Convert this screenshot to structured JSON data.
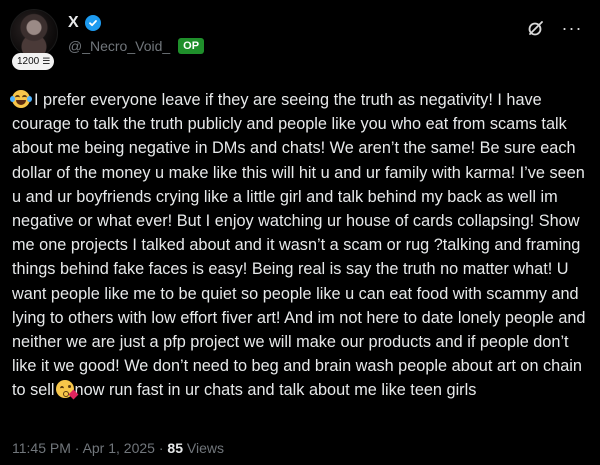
{
  "author": {
    "display_name": "X",
    "handle": "@_Necro_Void_",
    "op_badge": "OP",
    "level": "1200"
  },
  "icons": {
    "verified": "verified-check-icon",
    "grok": "grok-icon",
    "more": "more-icon"
  },
  "post": {
    "text_part1": "I prefer everyone leave if they are seeing the truth as negativity! I have courage to talk the truth publicly and people like you who eat from scams talk about me being negative in DMs and chats! We aren’t the same! Be sure each dollar of the money u make like this will hit u and ur family with karma! I’ve seen u and ur boyfriends crying like a little girl and talk behind my back as well im negative or what ever! But I enjoy watching ur house of cards collapsing! Show me one projects I talked about and it wasn’t a scam or rug ?talking and framing things behind fake faces is easy! Being real is say the truth no matter what! U want people like me to be quiet so people like u can eat food with scammy and lying to others with low effort fiver art! And im not here to date lonely people and neither we are just a pfp project we will make our products and if people don’t like it we good! We don’t need to beg and brain wash people about art on chain to sell",
    "text_part2": "now run fast in ur chats and talk about me like teen girls"
  },
  "meta": {
    "time": "11:45 PM",
    "separator": " · ",
    "date": "Apr 1, 2025",
    "separator2": " · ",
    "views_count": "85",
    "views_label": " Views"
  },
  "colors": {
    "background": "#000000",
    "text": "#e7e9ea",
    "secondary": "#71767b",
    "verified": "#1d9bf0",
    "op_badge": "#1f8f2b"
  }
}
